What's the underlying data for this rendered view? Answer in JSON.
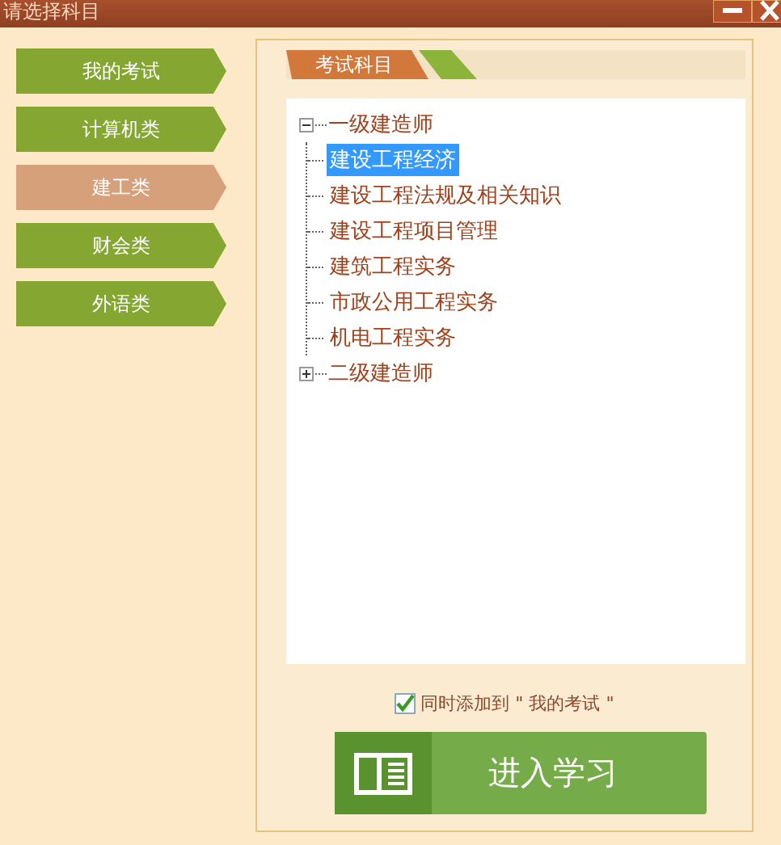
{
  "window": {
    "title": "请选择科目"
  },
  "sidebar": {
    "items": [
      {
        "label": "我的考试",
        "selected": false
      },
      {
        "label": "计算机类",
        "selected": false
      },
      {
        "label": "建工类",
        "selected": true
      },
      {
        "label": "财会类",
        "selected": false
      },
      {
        "label": "外语类",
        "selected": false
      }
    ]
  },
  "tabs": [
    {
      "label": "考试科目",
      "selected": true
    }
  ],
  "tree": [
    {
      "label": "一级建造师",
      "expanded": true,
      "children": [
        {
          "label": "建设工程经济",
          "selected": true
        },
        {
          "label": "建设工程法规及相关知识",
          "selected": false
        },
        {
          "label": "建设工程项目管理",
          "selected": false
        },
        {
          "label": "建筑工程实务",
          "selected": false
        },
        {
          "label": "市政公用工程实务",
          "selected": false
        },
        {
          "label": "机电工程实务",
          "selected": false
        }
      ]
    },
    {
      "label": "二级建造师",
      "expanded": false
    }
  ],
  "add_to_my_exams": {
    "label": "同时添加到 \" 我的考试 \"",
    "checked": true
  },
  "start_button": {
    "label": "进入学习"
  }
}
